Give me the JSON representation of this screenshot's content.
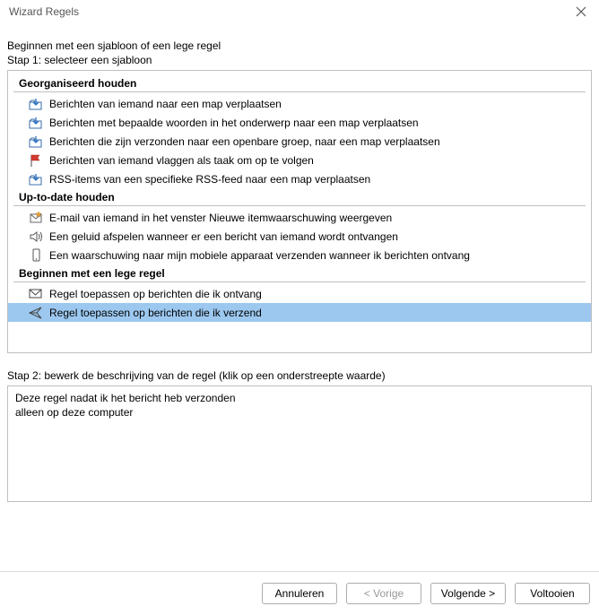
{
  "window": {
    "title": "Wizard Regels"
  },
  "intro": "Beginnen met een sjabloon of een lege regel",
  "step1_label": "Stap 1: selecteer een sjabloon",
  "groups": {
    "g1": {
      "header": "Georganiseerd houden",
      "items": {
        "i0": "Berichten van iemand naar een map verplaatsen",
        "i1": "Berichten met bepaalde woorden in het onderwerp naar een map verplaatsen",
        "i2": "Berichten die zijn verzonden naar een openbare groep, naar een map verplaatsen",
        "i3": "Berichten van iemand vlaggen als taak om op te volgen",
        "i4": "RSS-items van een specifieke RSS-feed naar een map verplaatsen"
      }
    },
    "g2": {
      "header": "Up-to-date houden",
      "items": {
        "i0": "E-mail van iemand in het venster Nieuwe itemwaarschuwing weergeven",
        "i1": "Een geluid afspelen wanneer er een bericht van iemand wordt ontvangen",
        "i2": "Een waarschuwing naar mijn mobiele apparaat verzenden wanneer ik berichten ontvang"
      }
    },
    "g3": {
      "header": "Beginnen met een lege regel",
      "items": {
        "i0": "Regel toepassen op berichten die ik ontvang",
        "i1": "Regel toepassen op berichten die ik verzend"
      }
    }
  },
  "step2_label": "Stap 2: bewerk de beschrijving van de regel (klik op een onderstreepte waarde)",
  "description": {
    "line1": "Deze regel nadat ik het bericht heb verzonden",
    "line2": "alleen op deze computer"
  },
  "buttons": {
    "cancel": "Annuleren",
    "back": "< Vorige",
    "next": "Volgende >",
    "finish": "Voltooien"
  }
}
